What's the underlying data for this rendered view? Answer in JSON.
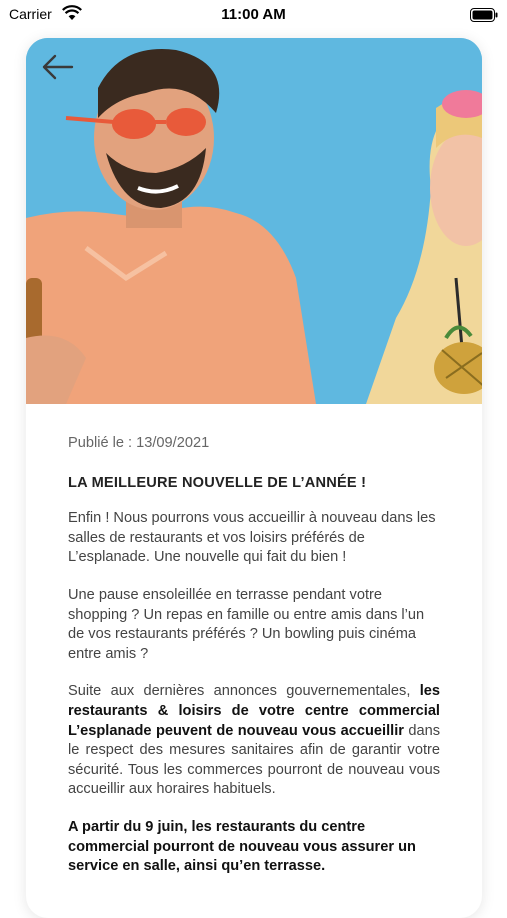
{
  "status_bar": {
    "carrier": "Carrier",
    "time": "11:00 AM"
  },
  "article": {
    "published": "Publié le : 13/09/2021",
    "headline": "LA MEILLEURE NOUVELLE DE L’ANNÉE !",
    "para1": "Enfin ! Nous pourrons vous accueillir à nouveau dans les salles de restaurants et vos loisirs préférés de L’esplanade. Une nouvelle qui fait du bien !",
    "para2": "Une pause ensoleillée en terrasse pendant votre shopping ? Un repas en famille ou entre amis dans l’un de vos restaurants préférés ? Un bowling puis cinéma entre amis ?",
    "para3_start": "Suite aux dernières annonces gouvernementales, ",
    "para3_bold": "les restaurants & loisirs de votre centre commercial L’esplanade peuvent de nouveau vous accueillir",
    "para3_end": " dans le respect des mesures sanitaires afin de garantir votre sécurité. Tous les commerces pourront de nouveau vous accueillir aux horaires habituels.",
    "para4": "A partir du 9 juin, les restaurants du centre commercial pourront de nouveau vous assurer un service en salle, ainsi qu’en terrasse."
  },
  "colors": {
    "sky": "#5fb8e0",
    "shirt": "#f0a37a",
    "text": "#444444"
  },
  "icons": {
    "back": "arrow-left-icon",
    "wifi": "wifi-icon",
    "battery": "battery-icon"
  }
}
